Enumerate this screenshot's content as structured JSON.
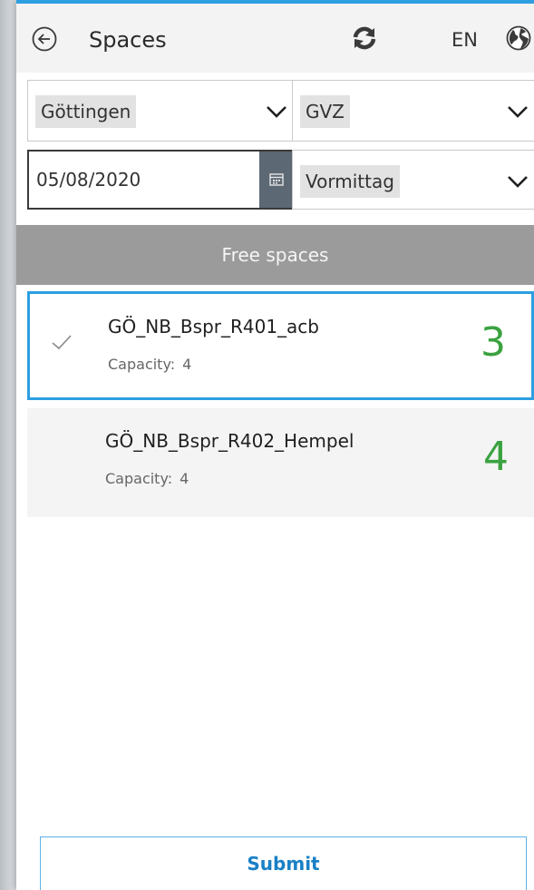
{
  "header": {
    "title": "Spaces",
    "language": "EN"
  },
  "filters": {
    "location": "Göttingen",
    "building": "GVZ",
    "date": "05/08/2020",
    "period": "Vormittag"
  },
  "banner": {
    "label": "Free spaces"
  },
  "spaces": [
    {
      "name": "GÖ_NB_Bspr_R401_acb",
      "capacity_label": "Capacity:",
      "capacity": "4",
      "free": "3",
      "selected": true
    },
    {
      "name": "GÖ_NB_Bspr_R402_Hempel",
      "capacity_label": "Capacity:",
      "capacity": "4",
      "free": "4",
      "selected": false
    }
  ],
  "actions": {
    "submit_label": "Submit"
  },
  "colors": {
    "accent": "#2d9fe0",
    "free_count": "#3aa23f",
    "banner": "#9b9b9b",
    "calendar_button": "#5c6873"
  },
  "icons": {
    "back": "back-arrow-circle-icon",
    "refresh": "refresh-icon",
    "language": "globe-icon",
    "dropdown": "chevron-down-icon",
    "calendar": "calendar-icon",
    "selected": "checkmark-icon"
  }
}
